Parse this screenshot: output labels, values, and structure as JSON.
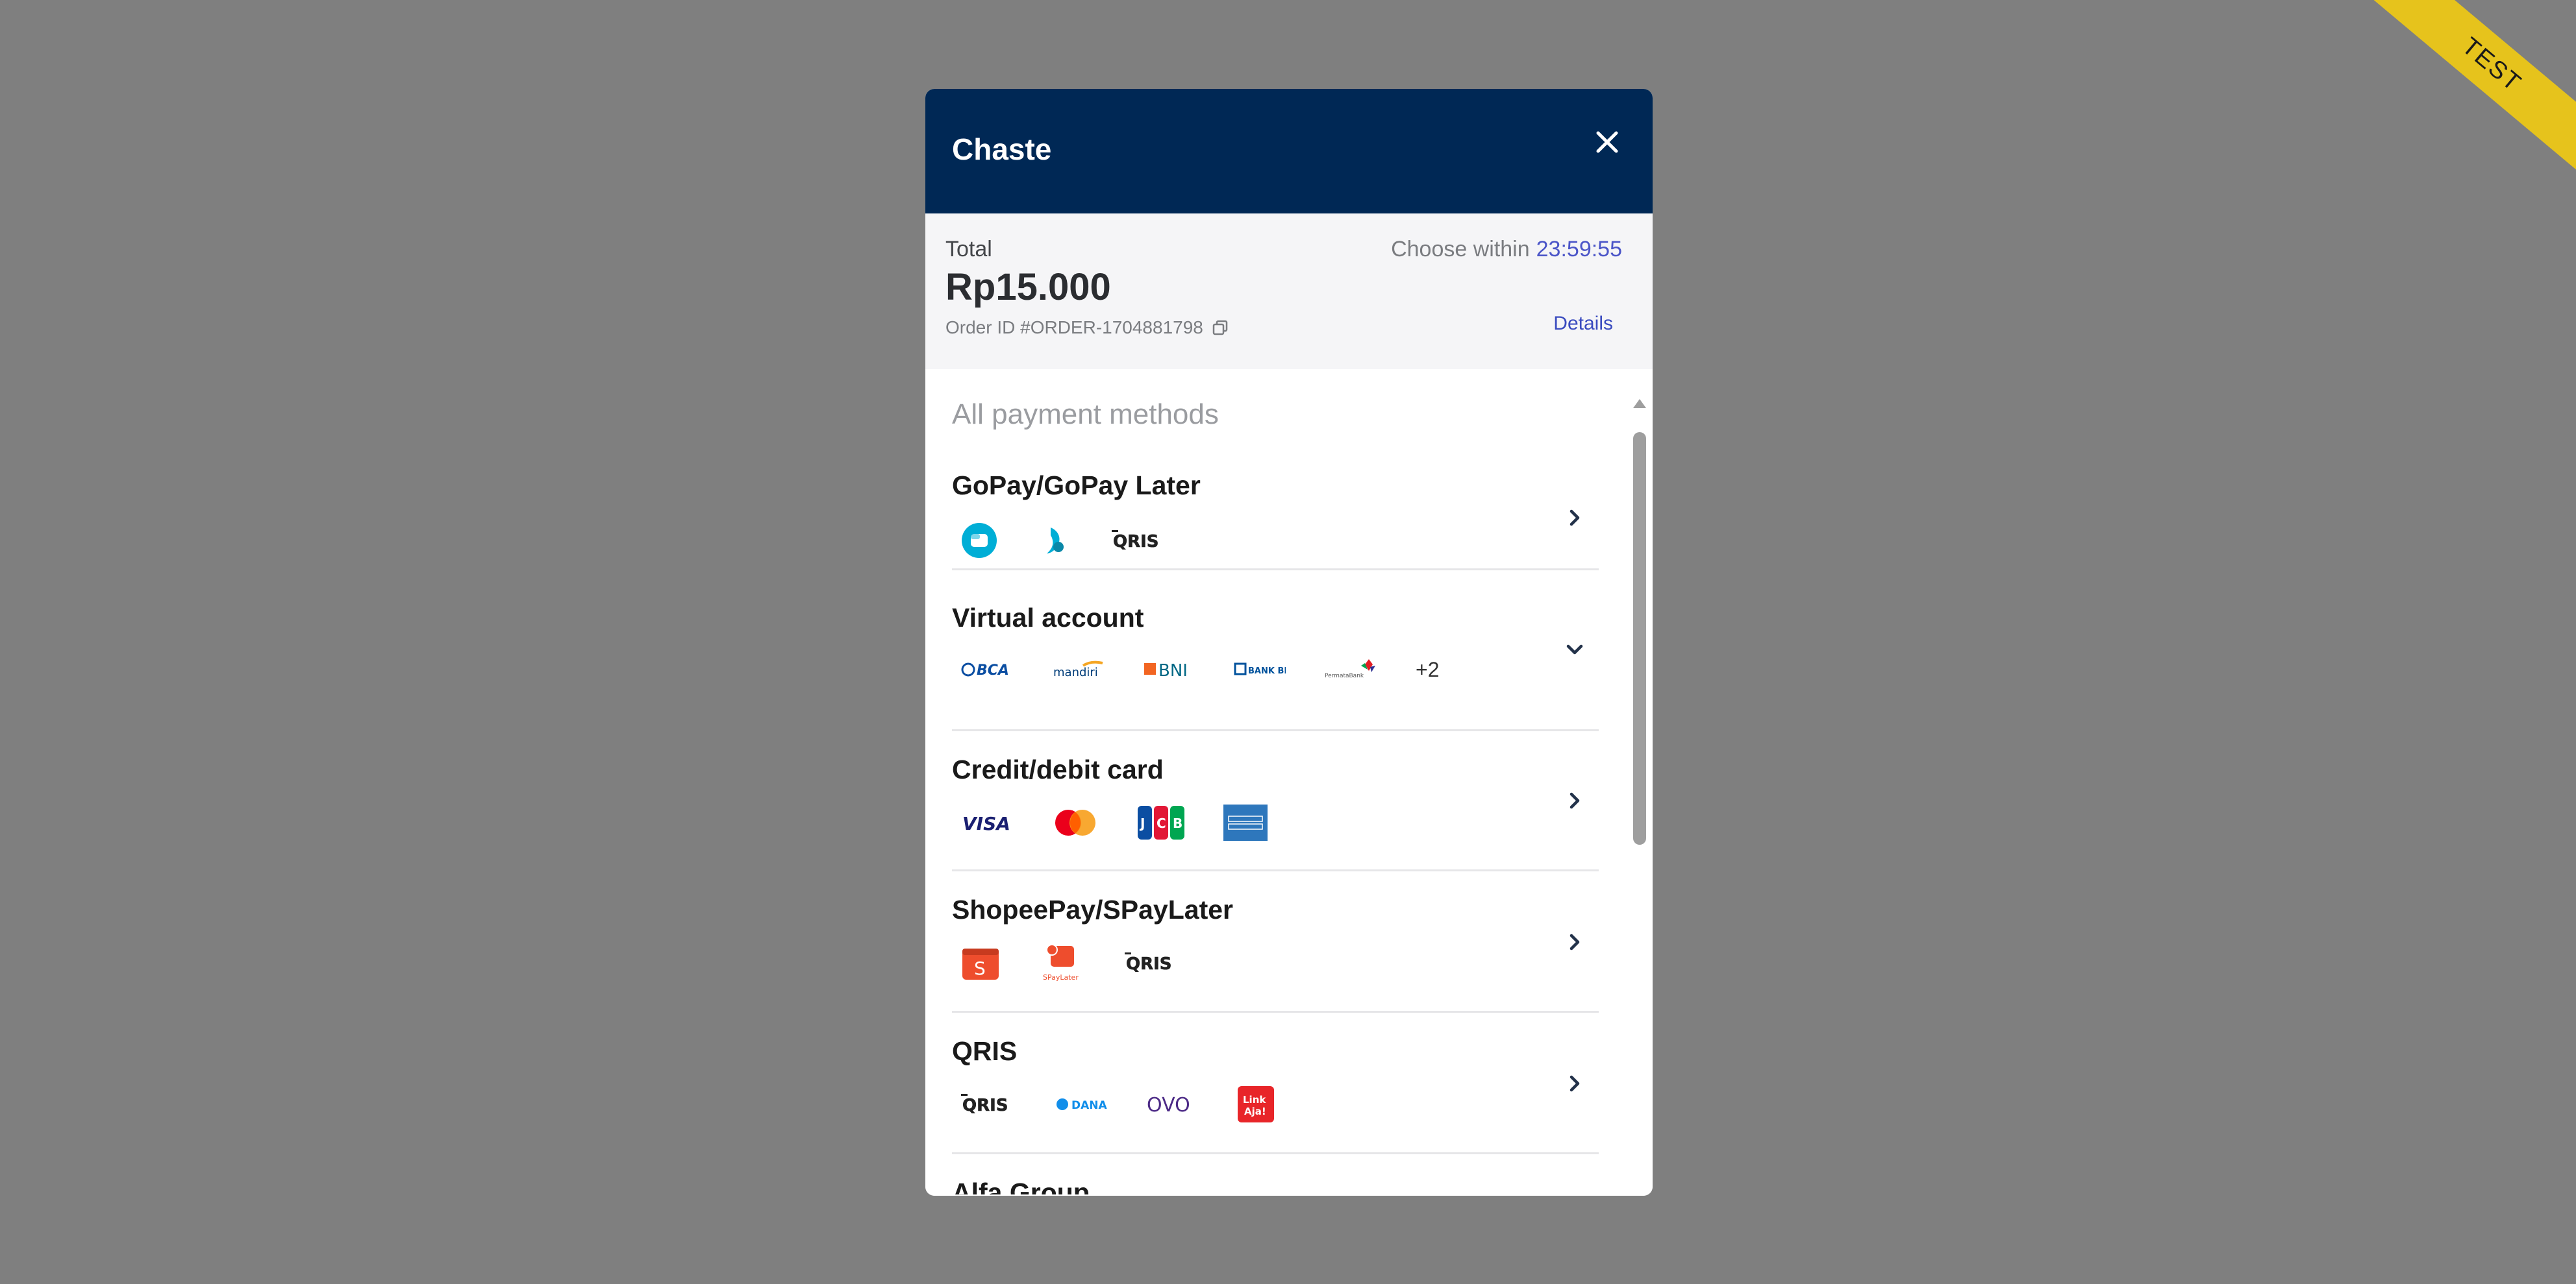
{
  "ribbon": {
    "label": "TEST"
  },
  "header": {
    "merchant": "Chaste"
  },
  "summary": {
    "total_label": "Total",
    "total_amount": "Rp15.000",
    "order_id": "Order ID #ORDER-1704881798",
    "timer_label": "Choose within",
    "timer_value": "23:59:55",
    "details_label": "Details"
  },
  "payment": {
    "section_title": "All payment methods",
    "methods": [
      {
        "name": "GoPay/GoPay Later",
        "logos": [
          "gopay-logo",
          "gopay-later-logo",
          "qris-logo"
        ]
      },
      {
        "name": "Virtual account",
        "logos": [
          "BCA",
          "mandiri",
          "BNI",
          "BANK BRI",
          "PermataBank"
        ],
        "more": "+2"
      },
      {
        "name": "Credit/debit card",
        "logos": [
          "VISA",
          "mastercard-logo",
          "JCB",
          "amex-logo"
        ]
      },
      {
        "name": "ShopeePay/SPayLater",
        "logos": [
          "shopeepay-logo",
          "SPayLater",
          "qris-logo"
        ]
      },
      {
        "name": "QRIS",
        "logos": [
          "QRIS",
          "DANA",
          "OVO",
          "Link Aja!"
        ]
      },
      {
        "name": "Alfa Group"
      }
    ]
  },
  "colors": {
    "header_bg": "#002855",
    "accent": "#3a4bbf",
    "ribbon": "#e6c31c",
    "overlay": "#7f7f7f"
  }
}
